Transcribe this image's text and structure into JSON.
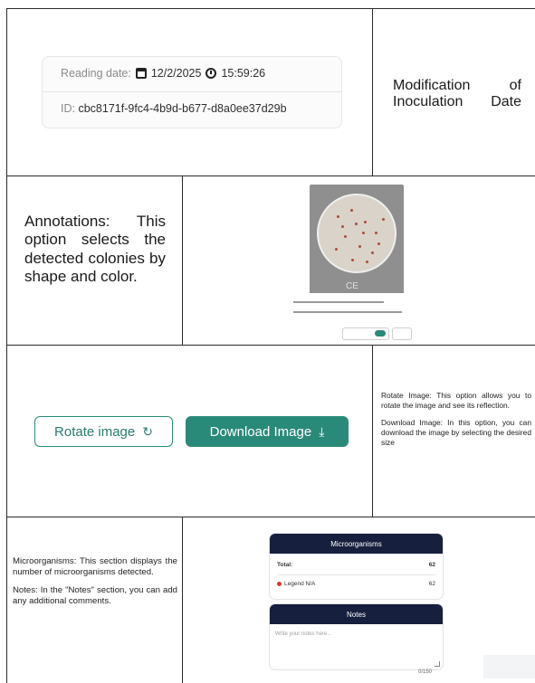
{
  "row1": {
    "reading_label": "Reading date:",
    "reading_date": "12/2/2025",
    "reading_time": "15:59:26",
    "id_label": "ID:",
    "id_value": "cbc8171f-9fc4-4b9d-b677-d8a0ee37d29b",
    "description": "Modification of Inoculation Date"
  },
  "row2": {
    "description": "Annotations: This option selects the detected colonies by shape and color.",
    "thumb_text": "CE"
  },
  "row3": {
    "rotate_label": "Rotate image",
    "download_label": "Download Image",
    "desc_rotate": "Rotate Image: This option allows you to rotate the image and see its reflection.",
    "desc_download": "Download Image: In this option, you can download the image by selecting the desired size"
  },
  "row4": {
    "desc_micro": "Microorganisms: This section displays the number of microorganisms detected.",
    "desc_notes": "Notes: In the \"Notes\" section, you can add any additional comments.",
    "micro_title": "Microorganisms",
    "total_label": "Total:",
    "total_value": "62",
    "legend_label": "Legend N/A",
    "legend_value": "62",
    "notes_title": "Notes",
    "notes_placeholder": "Write your notes here...",
    "notes_counter": "0/150"
  },
  "colors": {
    "accent": "#2a8a7a",
    "panel_header": "#161f3d",
    "legend_dot": "#d23a2a"
  }
}
